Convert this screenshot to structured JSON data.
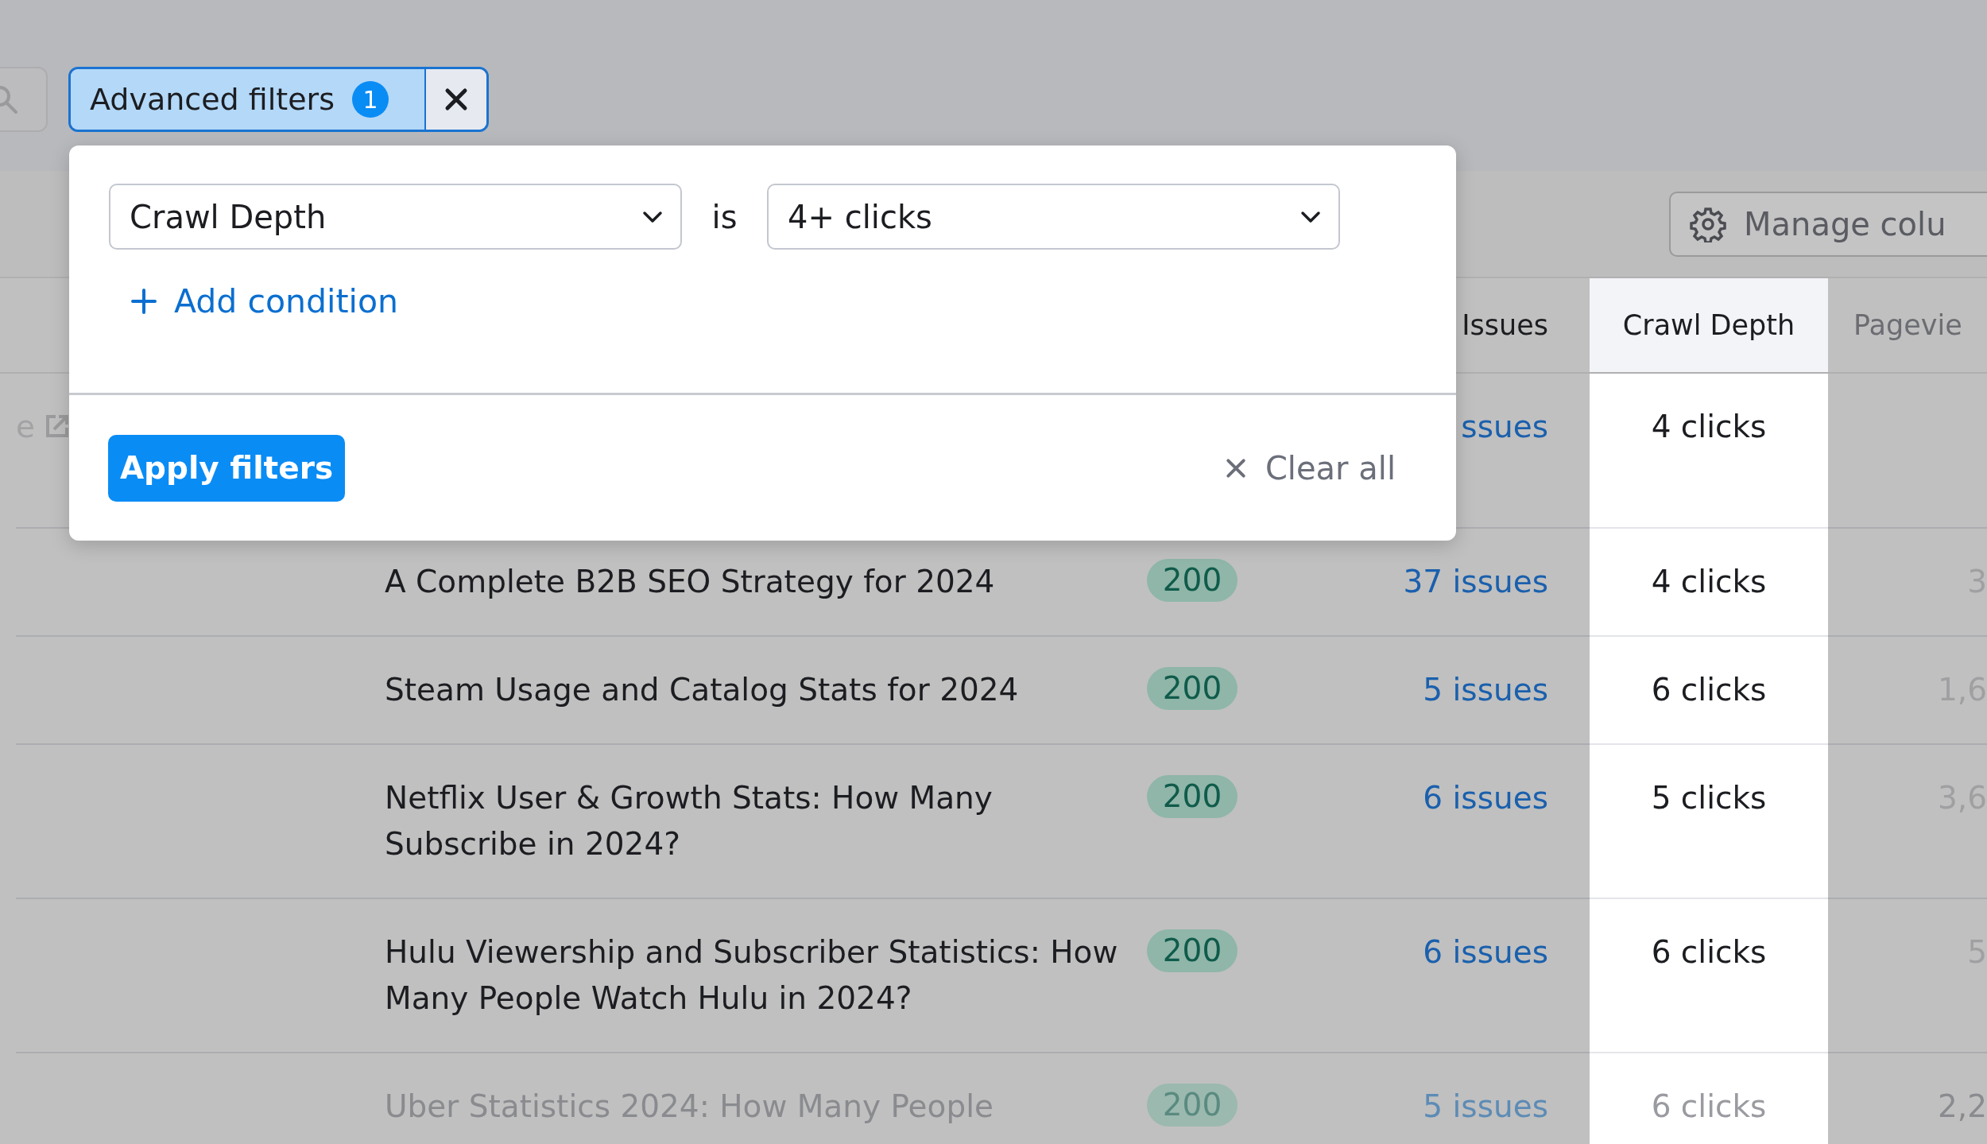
{
  "filter_button": {
    "label": "Advanced filters",
    "count": "1"
  },
  "filter_popup": {
    "conditions": [
      {
        "field": "Crawl Depth",
        "operator": "is",
        "value": "4+ clicks"
      }
    ],
    "add_label": "Add condition",
    "apply_label": "Apply filters",
    "clear_label": "Clear all"
  },
  "toolbar": {
    "manage_columns": "Manage colu"
  },
  "table": {
    "columns": [
      {
        "label": "Issues",
        "highlighted": false
      },
      {
        "label": "Crawl Depth",
        "highlighted": true
      },
      {
        "label": "Pagevie",
        "highlighted": false
      }
    ],
    "rows": [
      {
        "lead": "e",
        "issues": "ssues",
        "crawl_depth": "4 clicks"
      },
      {
        "title": "A Complete B2B SEO Strategy for 2024",
        "status": "200",
        "issues": "37 issues",
        "crawl_depth": "4 clicks",
        "pageviews": "3"
      },
      {
        "title": "Steam Usage and Catalog Stats for 2024",
        "status": "200",
        "issues": "5 issues",
        "crawl_depth": "6 clicks",
        "pageviews": "1,6"
      },
      {
        "title": "Netflix User & Growth Stats: How Many Subscribe in 2024?",
        "status": "200",
        "issues": "6 issues",
        "crawl_depth": "5 clicks",
        "pageviews": "3,6"
      },
      {
        "title": "Hulu Viewership and Subscriber Statistics: How Many People Watch Hulu in 2024?",
        "status": "200",
        "issues": "6 issues",
        "crawl_depth": "6 clicks",
        "pageviews": "5"
      },
      {
        "title": "Uber Statistics 2024: How Many People",
        "status": "200",
        "issues": "5 issues",
        "crawl_depth": "6 clicks",
        "pageviews": "2,2"
      }
    ]
  }
}
